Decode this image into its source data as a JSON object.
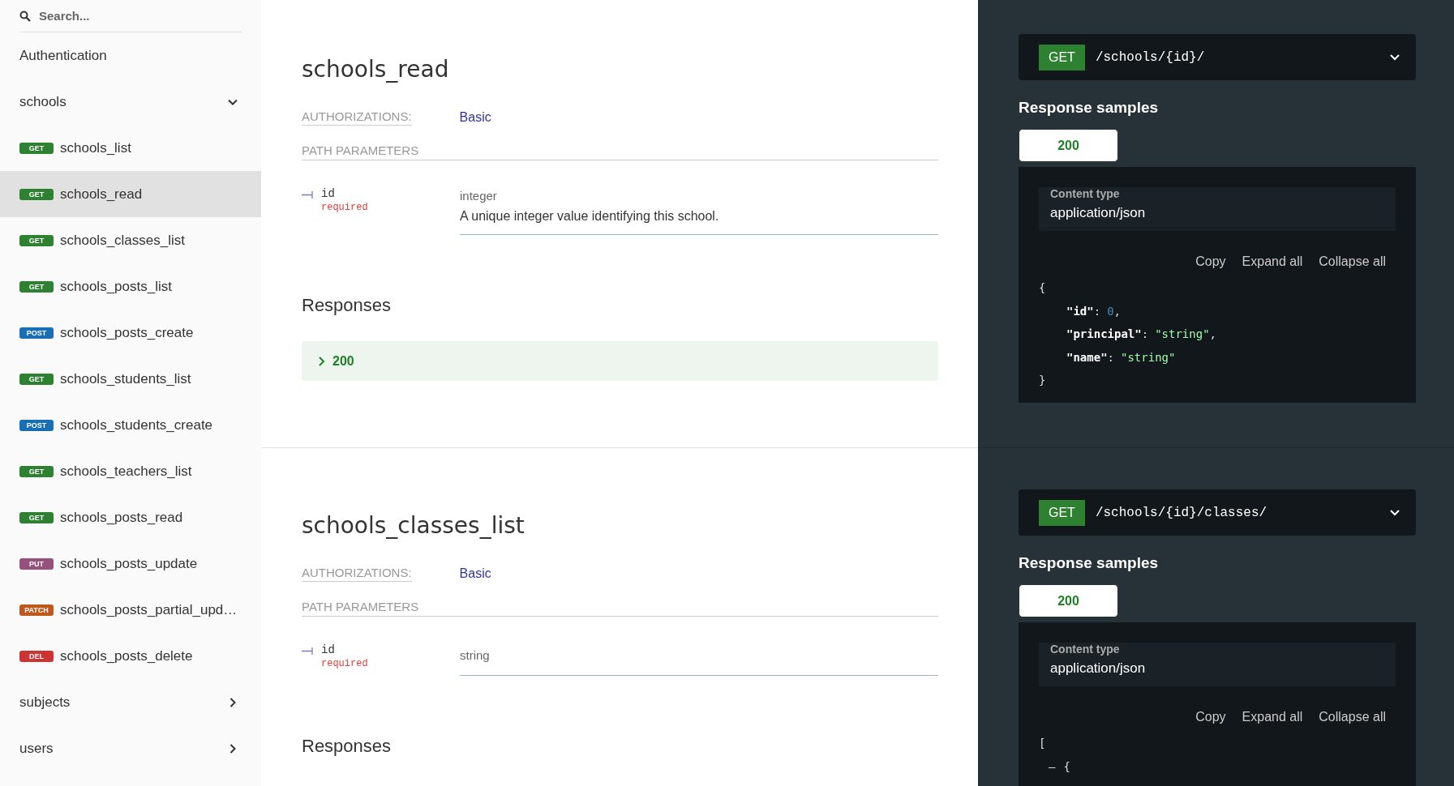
{
  "sidebar": {
    "search": {
      "placeholder": "Search..."
    },
    "items": [
      {
        "kind": "plain",
        "label": "Authentication"
      },
      {
        "kind": "group",
        "label": "schools",
        "expanded": true,
        "children": [
          {
            "method": "GET",
            "color": "#2f8132",
            "label": "schools_list",
            "selected": false
          },
          {
            "method": "GET",
            "color": "#2f8132",
            "label": "schools_read",
            "selected": true
          },
          {
            "method": "GET",
            "color": "#2f8132",
            "label": "schools_classes_list",
            "selected": false
          },
          {
            "method": "GET",
            "color": "#2f8132",
            "label": "schools_posts_list",
            "selected": false
          },
          {
            "method": "POST",
            "color": "#186fb5",
            "label": "schools_posts_create",
            "selected": false
          },
          {
            "method": "GET",
            "color": "#2f8132",
            "label": "schools_students_list",
            "selected": false
          },
          {
            "method": "POST",
            "color": "#186fb5",
            "label": "schools_students_create",
            "selected": false
          },
          {
            "method": "GET",
            "color": "#2f8132",
            "label": "schools_teachers_list",
            "selected": false
          },
          {
            "method": "GET",
            "color": "#2f8132",
            "label": "schools_posts_read",
            "selected": false
          },
          {
            "method": "PUT",
            "color": "#95507c",
            "label": "schools_posts_update",
            "selected": false
          },
          {
            "method": "PATCH",
            "color": "#bf581d",
            "label": "schools_posts_partial_upd…",
            "selected": false
          },
          {
            "method": "DEL",
            "color": "#cc3333",
            "label": "schools_posts_delete",
            "selected": false
          }
        ]
      },
      {
        "kind": "group",
        "label": "subjects",
        "expanded": false
      },
      {
        "kind": "group",
        "label": "users",
        "expanded": false
      }
    ]
  },
  "operations": [
    {
      "title": "schools_read",
      "auth_label": "AUTHORIZATIONS:",
      "auth": "Basic",
      "params_heading": "PATH PARAMETERS",
      "params": [
        {
          "name": "id",
          "required": "required",
          "type": "integer",
          "description": "A unique integer value identifying this school."
        }
      ],
      "responses_heading": "Responses",
      "responses": [
        {
          "code": "200",
          "expanded": false
        }
      ],
      "endpoint": {
        "method": "GET",
        "color": "#2f8132",
        "path": "/schools/{id}/",
        "expanded": false
      },
      "samples_heading": "Response samples",
      "tabs": [
        {
          "label": "200",
          "selected": true
        }
      ],
      "content_type_label": "Content type",
      "content_type": "application/json",
      "actions": [
        "Copy",
        "Expand all",
        "Collapse all"
      ],
      "sample": {
        "open": "{",
        "children": [
          {
            "tokens": [
              {
                "kind": "key",
                "text": "\"id\""
              },
              {
                "kind": "punct",
                "text": ":"
              },
              {
                "kind": "number",
                "text": "0"
              },
              {
                "kind": "punct",
                "text": ","
              }
            ]
          },
          {
            "tokens": [
              {
                "kind": "key",
                "text": "\"principal\""
              },
              {
                "kind": "punct",
                "text": ":"
              },
              {
                "kind": "string",
                "text": "\"string\""
              },
              {
                "kind": "punct",
                "text": ","
              }
            ]
          },
          {
            "tokens": [
              {
                "kind": "key",
                "text": "\"name\""
              },
              {
                "kind": "punct",
                "text": ":"
              },
              {
                "kind": "string",
                "text": "\"string\""
              }
            ]
          }
        ],
        "close": "}"
      }
    },
    {
      "title": "schools_classes_list",
      "auth_label": "AUTHORIZATIONS:",
      "auth": "Basic",
      "params_heading": "PATH PARAMETERS",
      "params": [
        {
          "name": "id",
          "required": "required",
          "type": "string"
        }
      ],
      "responses_heading": "Responses",
      "endpoint": {
        "method": "GET",
        "color": "#2f8132",
        "path": "/schools/{id}/classes/",
        "expanded": false
      },
      "samples_heading": "Response samples",
      "tabs": [
        {
          "label": "200",
          "selected": true
        }
      ],
      "content_type_label": "Content type",
      "content_type": "application/json",
      "actions": [
        "Copy",
        "Expand all",
        "Collapse all"
      ],
      "sample": {
        "open": "[",
        "children": [
          {
            "tokens": [
              {
                "kind": "toggle",
                "text": "–"
              },
              {
                "kind": "punct",
                "text": "{"
              }
            ]
          }
        ]
      }
    }
  ]
}
